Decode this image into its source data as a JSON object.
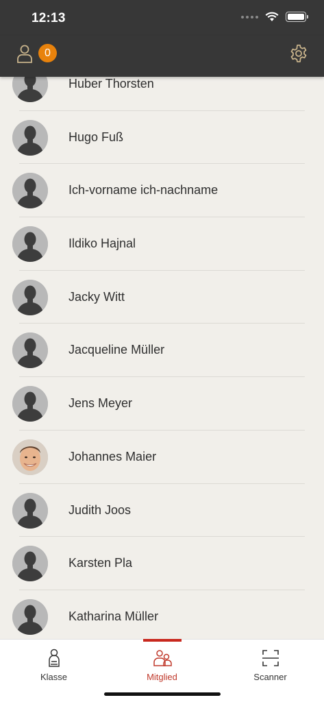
{
  "status_bar": {
    "time": "12:13"
  },
  "header": {
    "notification_count": "0",
    "accent_color": "#e8820c"
  },
  "members": [
    {
      "name": "Huber Thorsten",
      "avatar": "placeholder-avatar"
    },
    {
      "name": "Hugo Fuß",
      "avatar": "placeholder-avatar"
    },
    {
      "name": "Ich-vorname ich-nachname",
      "avatar": "placeholder-avatar"
    },
    {
      "name": "Ildiko Hajnal",
      "avatar": "placeholder-avatar"
    },
    {
      "name": "Jacky Witt",
      "avatar": "placeholder-avatar"
    },
    {
      "name": "Jacqueline Müller",
      "avatar": "placeholder-avatar"
    },
    {
      "name": "Jens Meyer",
      "avatar": "placeholder-avatar"
    },
    {
      "name": "Johannes Maier",
      "avatar": "photo-avatar"
    },
    {
      "name": "Judith Joos",
      "avatar": "placeholder-avatar"
    },
    {
      "name": "Karsten Pla",
      "avatar": "placeholder-avatar"
    },
    {
      "name": "Katharina Müller",
      "avatar": "placeholder-avatar"
    }
  ],
  "tabs": [
    {
      "label": "Klasse",
      "icon": "person-icon",
      "active": false
    },
    {
      "label": "Mitglied",
      "icon": "people-icon",
      "active": true
    },
    {
      "label": "Scanner",
      "icon": "scanner-icon",
      "active": false
    }
  ],
  "colors": {
    "active_tab": "#c8281e",
    "nav_background": "#373737",
    "list_background": "#f1efea"
  }
}
